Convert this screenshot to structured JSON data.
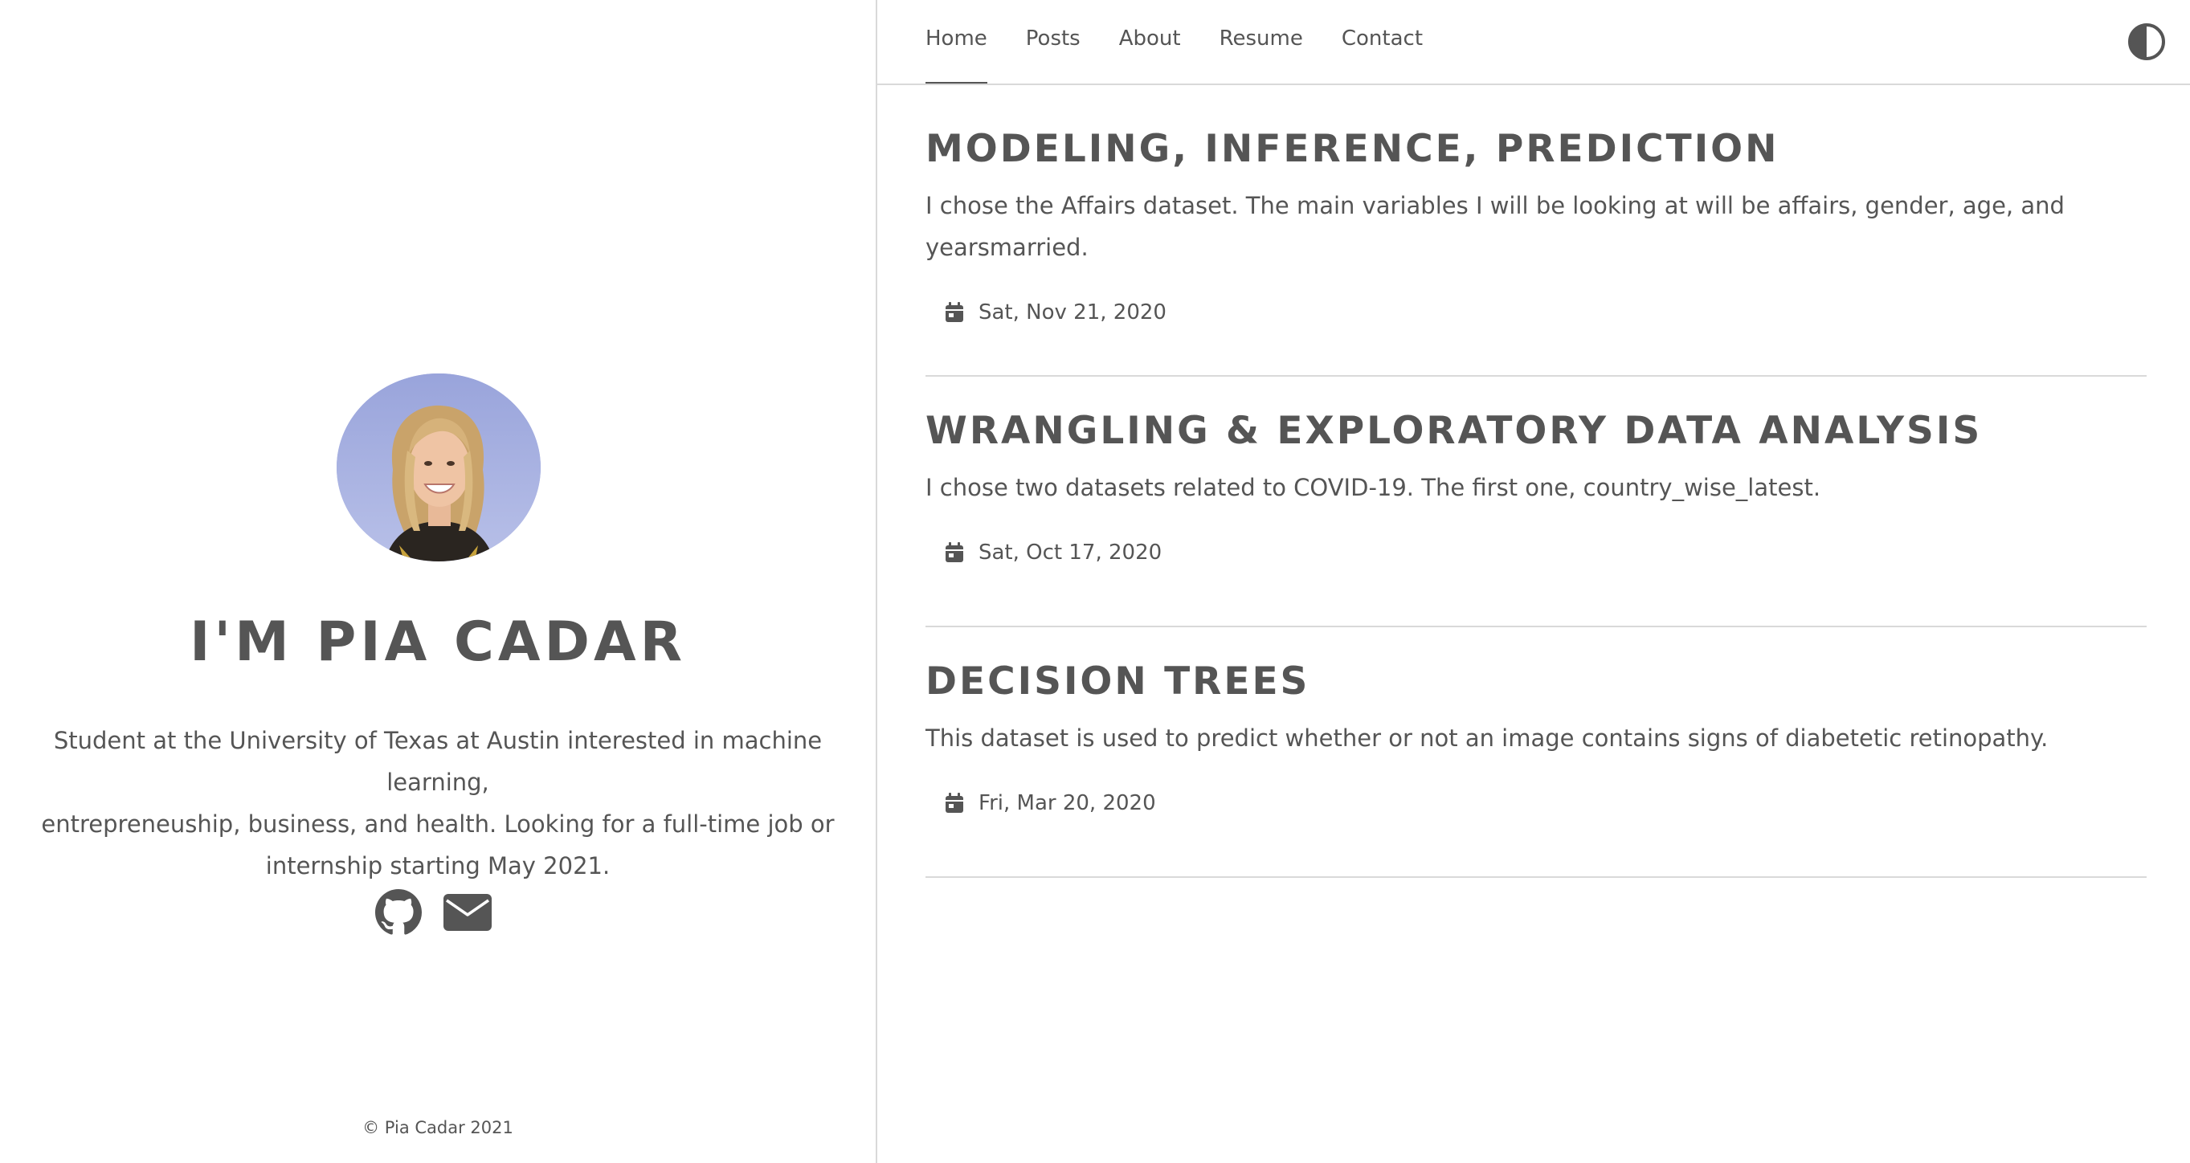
{
  "sidebar": {
    "title": "I'M PIA CADAR",
    "bio_lines": [
      "Student at the University of Texas at Austin interested in machine learning,",
      "entrepreneuship, business, and health. Looking for a full-time job or",
      "internship starting May 2021."
    ],
    "socials": [
      {
        "icon": "github-icon",
        "name": "github-link"
      },
      {
        "icon": "mail-icon",
        "name": "email-link"
      }
    ],
    "copyright": "© Pia Cadar 2021"
  },
  "nav": {
    "items": [
      {
        "label": "Home",
        "active": true
      },
      {
        "label": "Posts",
        "active": false
      },
      {
        "label": "About",
        "active": false
      },
      {
        "label": "Resume",
        "active": false
      },
      {
        "label": "Contact",
        "active": false
      }
    ],
    "theme_toggle_icon": "half-circle-theme-icon"
  },
  "posts": [
    {
      "title": "MODELING, INFERENCE, PREDICTION",
      "summary_lines": [
        "I chose the Affairs dataset. The main variables I will be looking at will be affairs, gender, age, and",
        "yearsmarried."
      ],
      "date": "Sat, Nov 21, 2020"
    },
    {
      "title": "WRANGLING & EXPLORATORY DATA ANALYSIS",
      "summary_lines": [
        "I chose two datasets related to COVID-19. The first one, country_wise_latest."
      ],
      "date": "Sat, Oct 17, 2020"
    },
    {
      "title": "DECISION TREES",
      "summary_lines": [
        "This dataset is used to predict whether or not an image contains signs of diabetetic retinopathy."
      ],
      "date": "Fri, Mar 20, 2020"
    }
  ],
  "colors": {
    "text": "#555555",
    "divider": "#d9d9d9",
    "avatar_bg": "#a4aee0"
  }
}
